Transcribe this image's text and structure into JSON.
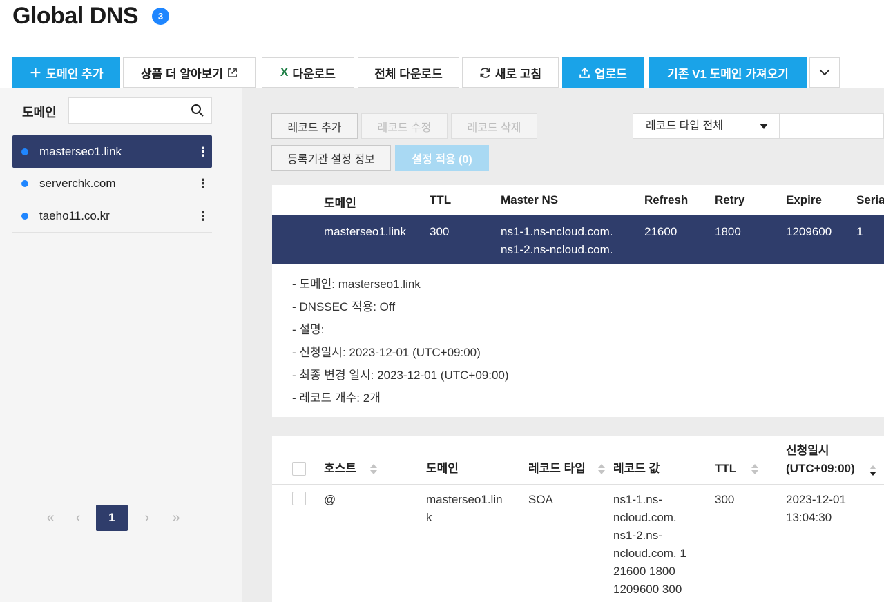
{
  "header": {
    "title": "Global DNS",
    "badge": "3"
  },
  "toolbar": {
    "add_domain": "도메인 추가",
    "learn_more": "상품 더 알아보기",
    "download": "다운로드",
    "download_all": "전체 다운로드",
    "refresh": "새로 고침",
    "upload": "업로드",
    "import_v1": "기존 V1 도메인 가져오기",
    "accent_color": "#1aa3e8"
  },
  "sidebar": {
    "label": "도메인",
    "search_placeholder": "",
    "items": [
      {
        "label": "masterseo1.link",
        "active": true
      },
      {
        "label": "serverchk.com",
        "active": false
      },
      {
        "label": "taeho11.co.kr",
        "active": false
      }
    ],
    "pager": {
      "current": "1",
      "first": "«",
      "prev": "‹",
      "next": "›",
      "last": "»"
    }
  },
  "record_actions": {
    "add": "레코드 추가",
    "edit": "레코드 수정",
    "delete": "레코드 삭제",
    "registrar": "등록기관 설정 정보",
    "apply": "설정 적용 (0)",
    "type_filter": "레코드 타입 전체"
  },
  "soa_table": {
    "headers": [
      "도메인",
      "TTL",
      "Master NS",
      "Refresh",
      "Retry",
      "Expire",
      "Seria"
    ],
    "row": {
      "domain": "masterseo1.link",
      "ttl": "300",
      "ns1": "ns1-1.ns-ncloud.com.",
      "ns2": "ns1-2.ns-ncloud.com.",
      "refresh": "21600",
      "retry": "1800",
      "expire": "1209600",
      "serial": "1"
    },
    "selected_color": "#2f3d6b"
  },
  "details": [
    "- 도메인: masterseo1.link",
    "- DNSSEC 적용: Off",
    "- 설명:",
    "- 신청일시: 2023-12-01 (UTC+09:00)",
    "- 최종 변경 일시: 2023-12-01 (UTC+09:00)",
    "- 레코드 개수: 2개"
  ],
  "records_table": {
    "headers": {
      "host": "호스트",
      "domain": "도메인",
      "type": "레코드 타입",
      "value": "레코드 값",
      "ttl": "TTL",
      "created_1": "신청일시",
      "created_2": "(UTC+09:00)"
    },
    "row": {
      "host": "@",
      "domain_1": "masterseo1.lin",
      "domain_2": "k",
      "type": "SOA",
      "value_lines": [
        "ns1-1.ns-",
        "ncloud.com.",
        "ns1-2.ns-",
        "ncloud.com. 1",
        "21600 1800",
        "1209600 300"
      ],
      "ttl": "300",
      "created_1": "2023-12-01",
      "created_2": "13:04:30"
    }
  }
}
